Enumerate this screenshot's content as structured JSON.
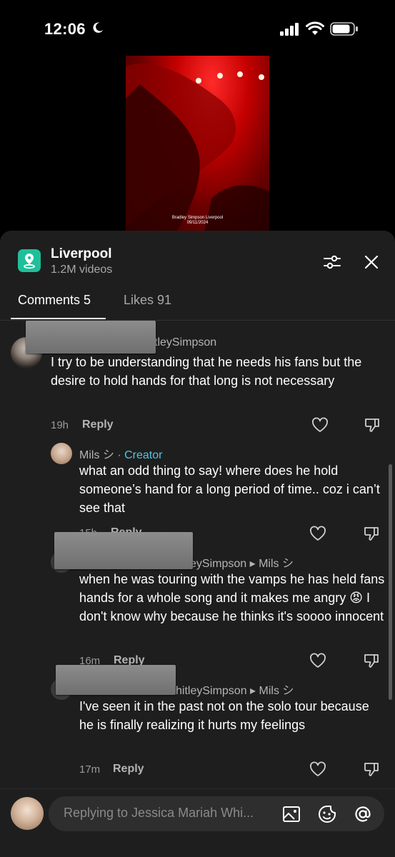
{
  "status": {
    "time": "12:06"
  },
  "video": {
    "caption_line1": "Bradley Simpson Liverpool",
    "caption_line2": "09/11/2024"
  },
  "header": {
    "title": "Liverpool",
    "subtitle": "1.2M videos"
  },
  "tabs": {
    "comments": "Comments 5",
    "likes": "Likes 91"
  },
  "comments": [
    {
      "username": "tleySimpson",
      "text": "I try to be understanding that he needs his fans but the desire to hold hands for that long is not necessary",
      "time": "19h",
      "reply": "Reply"
    },
    {
      "username": "Mils シ",
      "creator": "· Creator",
      "text": "what an odd thing to say! where does he hold someone’s hand for a long period of time.. coz i can’t see that",
      "time": "15h",
      "reply": "Reply"
    },
    {
      "username": "eySimpson ▸ Mils シ",
      "text": "when he was touring with the vamps he has held fans hands for a whole song and it makes me angry 😡 I don't know why because he thinks it's soooo innocent",
      "time": "16m",
      "reply": "Reply"
    },
    {
      "username": "hitleySimpson ▸ Mils シ",
      "text": "I've seen it in the past not on the solo tour because he is finally realizing it hurts my feelings",
      "time": "17m",
      "reply": "Reply"
    }
  ],
  "composer": {
    "placeholder": "Replying to Jessica Mariah Whi..."
  },
  "colors": {
    "sheet": "#1e1e1e",
    "accent_creator": "#4fc7e6",
    "place_icon": "#1fbf9a"
  }
}
